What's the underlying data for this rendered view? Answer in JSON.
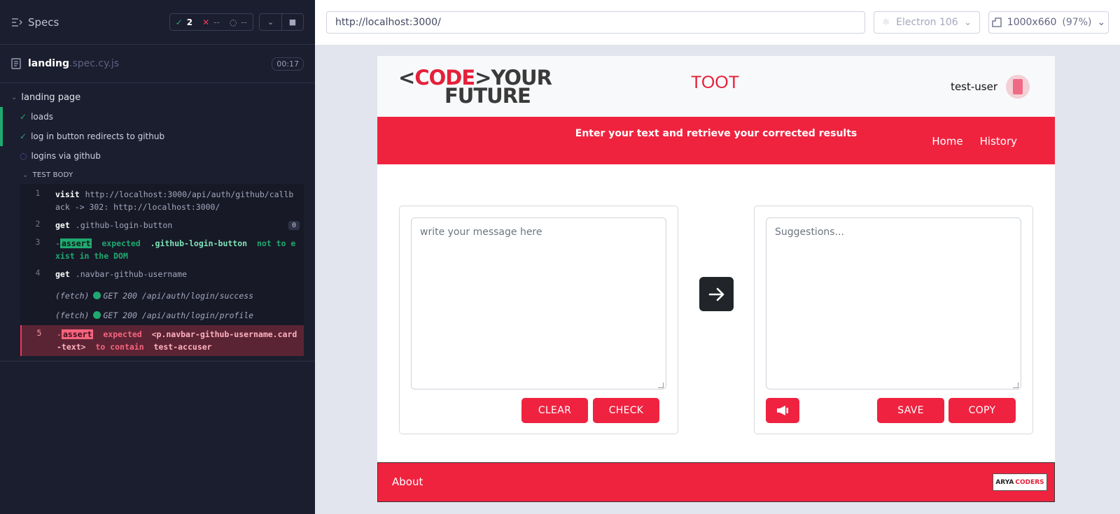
{
  "reporter": {
    "specs_label": "Specs",
    "stats": {
      "passed": "2",
      "failed": "--",
      "pending": "--"
    },
    "spec_file": {
      "name": "landing",
      "ext": ".spec.cy.js",
      "duration": "00:17"
    },
    "suite": "landing page",
    "tests": [
      "loads",
      "log in button redirects to github",
      "logins via github"
    ],
    "test_body_label": "TEST BODY",
    "commands": [
      {
        "num": "1",
        "name": "visit",
        "message": "http://localhost:3000/api/auth/github/callback -> 302: http://localhost:3000/"
      },
      {
        "num": "2",
        "name": "get",
        "message": ".github-login-button",
        "badge": "0"
      },
      {
        "num": "3",
        "prefix": "-",
        "tag": "assert",
        "w1": "expected",
        "w2": ".github-login-button",
        "w3": "not to exist in the DOM"
      },
      {
        "num": "4",
        "name": "get",
        "message": ".navbar-github-username"
      },
      {
        "name": "(fetch)",
        "message": "GET 200 /api/auth/login/success"
      },
      {
        "name": "(fetch)",
        "message": "GET 200 /api/auth/login/profile"
      },
      {
        "num": "5",
        "prefix": "-",
        "tag": "assert",
        "w1": "expected",
        "w2": "<p.navbar-github-username.card-text>",
        "w3": "to contain",
        "w4": "test-accuser"
      }
    ]
  },
  "aut": {
    "url": "http://localhost:3000/",
    "browser": "Electron 106",
    "viewport": "1000x660",
    "zoom": "(97%)"
  },
  "app": {
    "logo_line1_a": "<",
    "logo_line1_b": "CODE",
    "logo_line1_c": ">YOUR",
    "logo_line2": "FUTURE",
    "brand": "TOOT",
    "username": "test-user",
    "tagline": "Enter your text and retrieve your corrected results",
    "nav": [
      "Home",
      "History"
    ],
    "input_placeholder": "write your message here",
    "suggestions_placeholder": "Suggestions...",
    "buttons": {
      "clear": "CLEAR",
      "check": "CHECK",
      "save": "SAVE",
      "copy": "COPY"
    },
    "footer_about": "About",
    "footer_logo_a": "ARYA",
    "footer_logo_b": "CODERS"
  },
  "colors": {
    "accent": "#f0233f",
    "pass": "#1fa971",
    "fail": "#f0395b",
    "reporter_bg": "#1b1e2e"
  }
}
